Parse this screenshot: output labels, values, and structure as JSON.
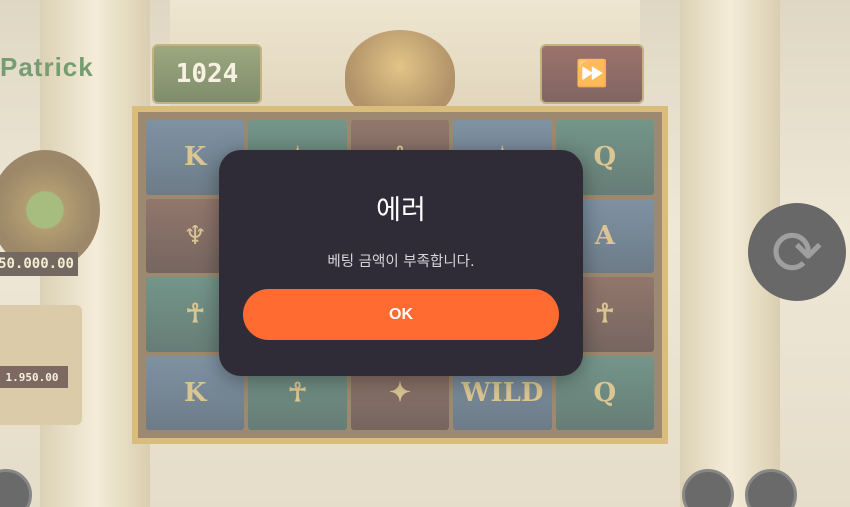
{
  "game": {
    "ways_count": "1024",
    "prize_amount": "50.000.00",
    "bet_amount": "1.950.00",
    "reel_symbols": [
      "K",
      "✦",
      "☥",
      "✦",
      "Q",
      "♆",
      "☥",
      "✦",
      "♆",
      "A",
      "☥",
      "✦",
      "☥",
      "✦",
      "☥",
      "K",
      "☥",
      "✦",
      "WILD",
      "Q"
    ],
    "turbo_icon": "fast-forward-icon",
    "spin_icon": "refresh-icon"
  },
  "dialog": {
    "title": "에러",
    "message": "베팅 금액이 부족합니다.",
    "ok_label": "OK"
  },
  "colors": {
    "dialog_bg": "#2f2c37",
    "ok_button": "#ff6b31",
    "text": "#ffffff"
  }
}
